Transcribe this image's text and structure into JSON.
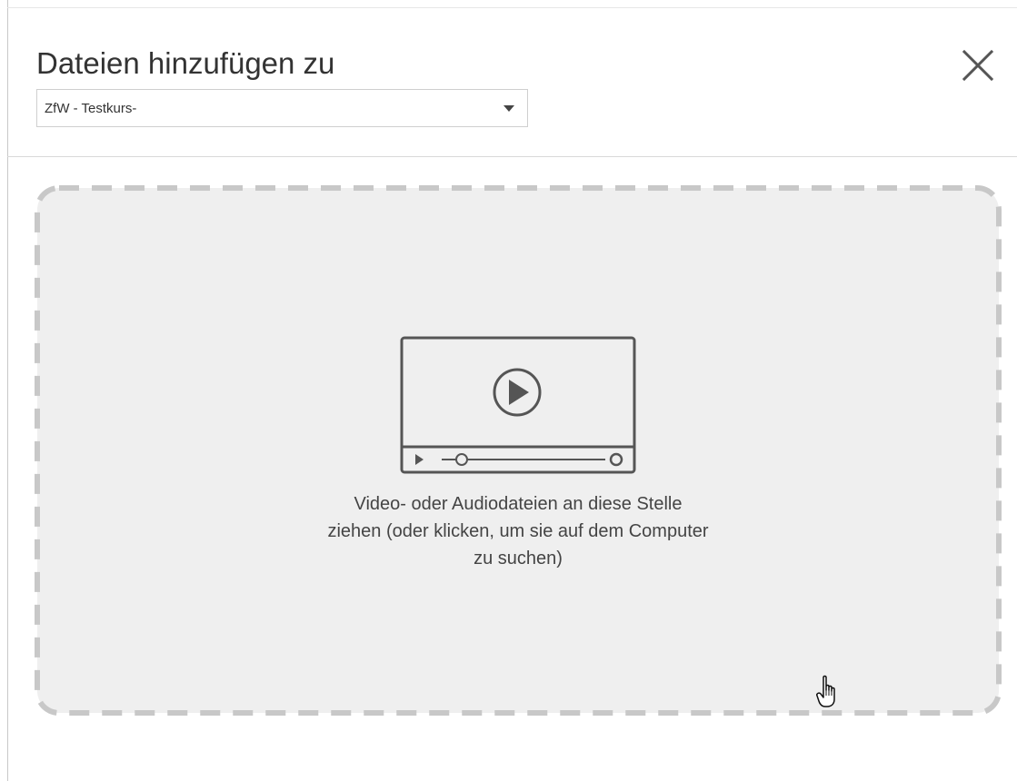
{
  "dialog": {
    "title": "Dateien hinzufügen zu",
    "close_icon": "close-icon",
    "destination": {
      "selected": "ZfW - Testkurs-",
      "arrow_icon": "chevron-down-icon"
    }
  },
  "dropzone": {
    "icon": "video-player-icon",
    "text_lines": [
      "Video- oder Audiodateien an diese Stelle",
      "ziehen (oder klicken, um sie auf dem Computer",
      "zu suchen)"
    ]
  },
  "cursor": {
    "icon": "hand-pointer-icon"
  },
  "colors": {
    "dropzone_bg": "#efefef",
    "dropzone_border": "#c8c8c8",
    "icon_stroke": "#555555",
    "text": "#444444"
  }
}
